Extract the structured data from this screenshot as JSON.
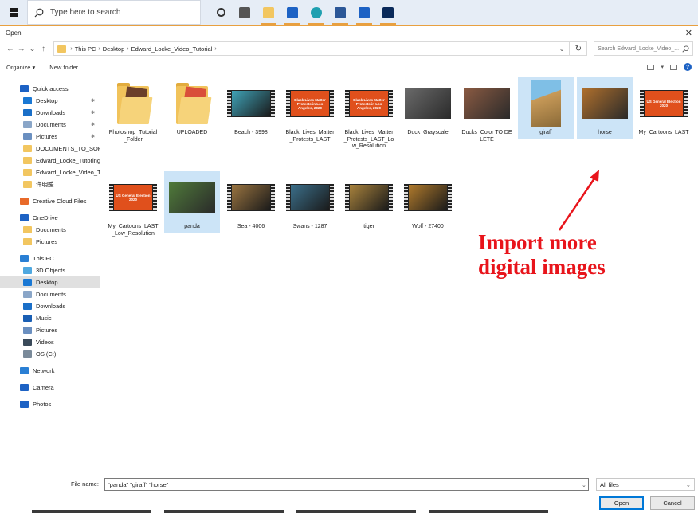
{
  "taskbar": {
    "search_placeholder": "Type here to search",
    "icons": [
      "task-view-icon",
      "widgets-icon",
      "file-explorer-icon",
      "mail-icon",
      "edge-icon",
      "word-icon",
      "photos-icon",
      "photoshop-icon"
    ]
  },
  "dialog": {
    "title": "Open",
    "close": "✕",
    "breadcrumb": [
      "This PC",
      "Desktop",
      "Edward_Locke_Video_Tutorial"
    ],
    "search_placeholder": "Search Edward_Locke_Video_...",
    "toolbar": {
      "organize": "Organize ▾",
      "new_folder": "New folder"
    }
  },
  "sidebar": {
    "items": [
      {
        "label": "Quick access",
        "icon": "star-icon",
        "color": "#1d62c4",
        "indent": 0
      },
      {
        "label": "Desktop",
        "icon": "desktop-icon",
        "color": "#1a78d4",
        "indent": 1,
        "pinned": true
      },
      {
        "label": "Downloads",
        "icon": "downloads-icon",
        "color": "#1a6fc8",
        "indent": 1,
        "pinned": true
      },
      {
        "label": "Documents",
        "icon": "documents-icon",
        "color": "#8aa6c8",
        "indent": 1,
        "pinned": true
      },
      {
        "label": "Pictures",
        "icon": "pictures-icon",
        "color": "#6a8fc0",
        "indent": 1,
        "pinned": true
      },
      {
        "label": "DOCUMENTS_TO_SORT",
        "icon": "folder-icon",
        "color": "#f2c660",
        "indent": 1
      },
      {
        "label": "Edward_Locke_Tutoring",
        "icon": "folder-icon",
        "color": "#f2c660",
        "indent": 1
      },
      {
        "label": "Edward_Locke_Video_Tu",
        "icon": "folder-icon",
        "color": "#f2c660",
        "indent": 1
      },
      {
        "label": "许明媛",
        "icon": "folder-icon",
        "color": "#f2c660",
        "indent": 1
      },
      {
        "gap": true
      },
      {
        "label": "Creative Cloud Files",
        "icon": "creative-cloud-icon",
        "color": "#e86a2a",
        "indent": 0
      },
      {
        "gap": true
      },
      {
        "label": "OneDrive",
        "icon": "onedrive-icon",
        "color": "#1d62c4",
        "indent": 0
      },
      {
        "label": "Documents",
        "icon": "folder-icon",
        "color": "#f2c660",
        "indent": 1
      },
      {
        "label": "Pictures",
        "icon": "folder-icon",
        "color": "#f2c660",
        "indent": 1
      },
      {
        "gap": true
      },
      {
        "label": "This PC",
        "icon": "this-pc-icon",
        "color": "#2a7fd4",
        "indent": 0
      },
      {
        "label": "3D Objects",
        "icon": "3d-objects-icon",
        "color": "#4fa8e0",
        "indent": 1
      },
      {
        "label": "Desktop",
        "icon": "desktop-icon",
        "color": "#1a78d4",
        "indent": 1,
        "selected": true
      },
      {
        "label": "Documents",
        "icon": "documents-icon",
        "color": "#8aa6c8",
        "indent": 1
      },
      {
        "label": "Downloads",
        "icon": "downloads-icon",
        "color": "#1a6fc8",
        "indent": 1
      },
      {
        "label": "Music",
        "icon": "music-icon",
        "color": "#1a5fb4",
        "indent": 1
      },
      {
        "label": "Pictures",
        "icon": "pictures-icon",
        "color": "#6a8fc0",
        "indent": 1
      },
      {
        "label": "Videos",
        "icon": "videos-icon",
        "color": "#3a4a5a",
        "indent": 1
      },
      {
        "label": "OS (C:)",
        "icon": "drive-icon",
        "color": "#7a8a9a",
        "indent": 1
      },
      {
        "gap": true
      },
      {
        "label": "Network",
        "icon": "network-icon",
        "color": "#2a7fd4",
        "indent": 0
      },
      {
        "gap": true
      },
      {
        "label": "Camera",
        "icon": "camera-icon",
        "color": "#1d62c4",
        "indent": 0
      },
      {
        "gap": true
      },
      {
        "label": "Photos",
        "icon": "photos-icon",
        "color": "#1d62c4",
        "indent": 0
      }
    ]
  },
  "files": [
    {
      "name": "Photoshop_Tutorial_Folder",
      "kind": "folder",
      "paper": "#6b3f2a",
      "row": 0,
      "col": 0
    },
    {
      "name": "UPLOADED",
      "kind": "folder",
      "paper": "#d94f3a",
      "row": 0,
      "col": 1
    },
    {
      "name": "Beach - 3998",
      "kind": "video",
      "color": "#3fa3b8",
      "row": 0,
      "col": 2
    },
    {
      "name": "Black_Lives_Matter_Protests_LAST",
      "kind": "video",
      "color": "#e0501c",
      "poster": "Black Lives Matter Protests in Los Angeles, 2020",
      "row": 0,
      "col": 3
    },
    {
      "name": "Black_Lives_Matter_Protests_LAST_Low_Resolution",
      "kind": "video",
      "color": "#e0501c",
      "poster": "Black Lives Matter Protests in Los Angeles, 2020",
      "row": 0,
      "col": 4
    },
    {
      "name": "Duck_Grayscale",
      "kind": "photo",
      "color": "#6a6a6a",
      "row": 0,
      "col": 5
    },
    {
      "name": "Ducks_Color TO DELETE",
      "kind": "photo",
      "color": "#8a5a42",
      "row": 0,
      "col": 6
    },
    {
      "name": "giraff",
      "kind": "photo-tall",
      "color": "#c89a58",
      "selected": true,
      "row": 0,
      "col": 7
    },
    {
      "name": "horse",
      "kind": "photo",
      "color": "#b0702c",
      "selected": true,
      "row": 0,
      "col": 8
    },
    {
      "name": "My_Cartoons_LAST",
      "kind": "video",
      "color": "#e0501c",
      "poster": "US General Election 2020",
      "row": 0,
      "col": 9
    },
    {
      "name": "My_Cartoons_LAST_Low_Resolution",
      "kind": "video",
      "color": "#e0501c",
      "poster": "US General Election 2020",
      "row": 1,
      "col": 0
    },
    {
      "name": "panda",
      "kind": "photo",
      "color": "#4f7a3a",
      "selected": true,
      "row": 1,
      "col": 1
    },
    {
      "name": "Sea - 4006",
      "kind": "video",
      "color": "#9a7440",
      "row": 1,
      "col": 2
    },
    {
      "name": "Swans - 1287",
      "kind": "video",
      "color": "#3b6f8a",
      "row": 1,
      "col": 3
    },
    {
      "name": "tiger",
      "kind": "video",
      "color": "#a8823c",
      "row": 1,
      "col": 4
    },
    {
      "name": "Wolf - 27400",
      "kind": "video",
      "color": "#b07a2c",
      "row": 1,
      "col": 5
    }
  ],
  "annotation": {
    "line1": "Import more",
    "line2": "digital images",
    "color": "#e8141b"
  },
  "bottom": {
    "file_name_label": "File name:",
    "file_name_value": "\"panda\" \"giraff\" \"horse\"",
    "filter": "All files",
    "open": "Open",
    "cancel": "Cancel"
  }
}
